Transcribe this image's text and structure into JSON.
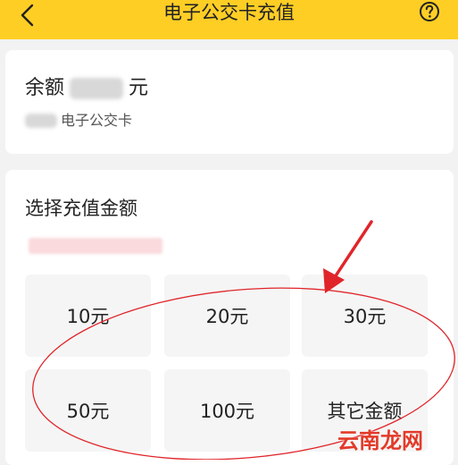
{
  "header": {
    "title": "电子公交卡充值",
    "back_icon": "chevron-left-icon",
    "help_icon": "question-circle-icon",
    "bg_color": "#ffce25"
  },
  "balance": {
    "label": "余额",
    "unit": "元",
    "card_name": "电子公交卡"
  },
  "recharge": {
    "title": "选择充值金额",
    "options": [
      "10元",
      "20元",
      "30元",
      "50元",
      "100元",
      "其它金额"
    ]
  },
  "annotation": {
    "arrow_color": "#e0252a",
    "ellipse_color": "#e0252a"
  },
  "watermark": {
    "text": "云南龙网"
  }
}
